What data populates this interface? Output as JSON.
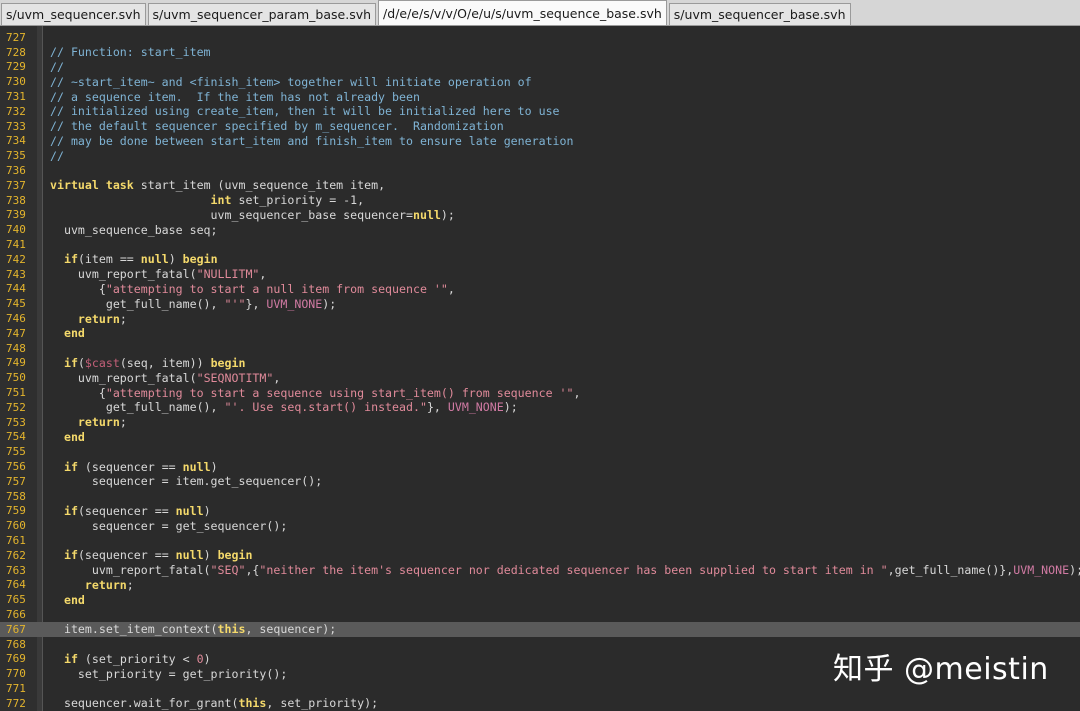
{
  "tabs": [
    {
      "label": "s/uvm_sequencer.svh",
      "active": false
    },
    {
      "label": "s/uvm_sequencer_param_base.svh",
      "active": false
    },
    {
      "label": "/d/e/e/s/v/v/O/e/u/s/uvm_sequence_base.svh",
      "active": true
    },
    {
      "label": "s/uvm_sequencer_base.svh",
      "active": false
    }
  ],
  "watermark": "知乎 @meistin",
  "colors": {
    "background": "#2b2b2b",
    "line_number": "#e4b52d",
    "comment": "#7fb3d4",
    "keyword": "#f4d96b",
    "string": "#e08a9a",
    "current_line": "#5a5a5a"
  },
  "code_lines": [
    {
      "n": "727",
      "t": [
        [
          "",
          ""
        ]
      ]
    },
    {
      "n": "728",
      "t": [
        [
          "com",
          "// Function: start_item"
        ]
      ]
    },
    {
      "n": "729",
      "t": [
        [
          "com",
          "//"
        ]
      ]
    },
    {
      "n": "730",
      "t": [
        [
          "com",
          "// ~start_item~ and <finish_item> together will initiate operation of"
        ]
      ]
    },
    {
      "n": "731",
      "t": [
        [
          "com",
          "// a sequence item.  If the item has not already been"
        ]
      ]
    },
    {
      "n": "732",
      "t": [
        [
          "com",
          "// initialized using create_item, then it will be initialized here to use"
        ]
      ]
    },
    {
      "n": "733",
      "t": [
        [
          "com",
          "// the default sequencer specified by m_sequencer.  Randomization"
        ]
      ]
    },
    {
      "n": "734",
      "t": [
        [
          "com",
          "// may be done between start_item and finish_item to ensure late generation"
        ]
      ]
    },
    {
      "n": "735",
      "t": [
        [
          "com",
          "//"
        ]
      ]
    },
    {
      "n": "736",
      "t": [
        [
          "",
          ""
        ]
      ]
    },
    {
      "n": "737",
      "t": [
        [
          "kw",
          "virtual task"
        ],
        [
          "",
          " start_item (uvm_sequence_item item,"
        ]
      ]
    },
    {
      "n": "738",
      "t": [
        [
          "",
          "                       "
        ],
        [
          "kw",
          "int"
        ],
        [
          "",
          " set_priority = -1,"
        ]
      ]
    },
    {
      "n": "739",
      "t": [
        [
          "",
          "                       uvm_sequencer_base sequencer="
        ],
        [
          "kw",
          "null"
        ],
        [
          "",
          ");"
        ]
      ]
    },
    {
      "n": "740",
      "t": [
        [
          "",
          "  uvm_sequence_base seq;"
        ]
      ]
    },
    {
      "n": "741",
      "t": [
        [
          "",
          ""
        ]
      ]
    },
    {
      "n": "742",
      "t": [
        [
          "",
          "  "
        ],
        [
          "kw",
          "if"
        ],
        [
          "",
          "(item == "
        ],
        [
          "kw",
          "null"
        ],
        [
          "",
          ") "
        ],
        [
          "kw",
          "begin"
        ]
      ]
    },
    {
      "n": "743",
      "t": [
        [
          "",
          "    uvm_report_fatal("
        ],
        [
          "str",
          "\"NULLITM\""
        ],
        [
          "",
          ","
        ]
      ]
    },
    {
      "n": "744",
      "t": [
        [
          "",
          "       {"
        ],
        [
          "str",
          "\"attempting to start a null item from sequence '\""
        ],
        [
          "",
          ","
        ]
      ]
    },
    {
      "n": "745",
      "t": [
        [
          "",
          "        get_full_name(), "
        ],
        [
          "str",
          "\"'\""
        ],
        [
          "",
          "}, "
        ],
        [
          "const",
          "UVM_NONE"
        ],
        [
          "",
          ");"
        ]
      ]
    },
    {
      "n": "746",
      "t": [
        [
          "",
          "    "
        ],
        [
          "kw",
          "return"
        ],
        [
          "",
          ";"
        ]
      ]
    },
    {
      "n": "747",
      "t": [
        [
          "",
          "  "
        ],
        [
          "kw",
          "end"
        ]
      ]
    },
    {
      "n": "748",
      "t": [
        [
          "",
          ""
        ]
      ]
    },
    {
      "n": "749",
      "t": [
        [
          "",
          "  "
        ],
        [
          "kw",
          "if"
        ],
        [
          "",
          "("
        ],
        [
          "sys",
          "$cast"
        ],
        [
          "",
          "(seq, item)) "
        ],
        [
          "kw",
          "begin"
        ]
      ]
    },
    {
      "n": "750",
      "t": [
        [
          "",
          "    uvm_report_fatal("
        ],
        [
          "str",
          "\"SEQNOTITM\""
        ],
        [
          "",
          ","
        ]
      ]
    },
    {
      "n": "751",
      "t": [
        [
          "",
          "       {"
        ],
        [
          "str",
          "\"attempting to start a sequence using start_item() from sequence '\""
        ],
        [
          "",
          ","
        ]
      ]
    },
    {
      "n": "752",
      "t": [
        [
          "",
          "        get_full_name(), "
        ],
        [
          "str",
          "\"'. Use seq.start() instead.\""
        ],
        [
          "",
          "}, "
        ],
        [
          "const",
          "UVM_NONE"
        ],
        [
          "",
          ");"
        ]
      ]
    },
    {
      "n": "753",
      "t": [
        [
          "",
          "    "
        ],
        [
          "kw",
          "return"
        ],
        [
          "",
          ";"
        ]
      ]
    },
    {
      "n": "754",
      "t": [
        [
          "",
          "  "
        ],
        [
          "kw",
          "end"
        ]
      ]
    },
    {
      "n": "755",
      "t": [
        [
          "",
          ""
        ]
      ]
    },
    {
      "n": "756",
      "t": [
        [
          "",
          "  "
        ],
        [
          "kw",
          "if"
        ],
        [
          "",
          " (sequencer == "
        ],
        [
          "kw",
          "null"
        ],
        [
          "",
          ")"
        ]
      ]
    },
    {
      "n": "757",
      "t": [
        [
          "",
          "      sequencer = item.get_sequencer();"
        ]
      ]
    },
    {
      "n": "758",
      "t": [
        [
          "",
          ""
        ]
      ]
    },
    {
      "n": "759",
      "t": [
        [
          "",
          "  "
        ],
        [
          "kw",
          "if"
        ],
        [
          "",
          "(sequencer == "
        ],
        [
          "kw",
          "null"
        ],
        [
          "",
          ")"
        ]
      ]
    },
    {
      "n": "760",
      "t": [
        [
          "",
          "      sequencer = get_sequencer();"
        ]
      ]
    },
    {
      "n": "761",
      "t": [
        [
          "",
          ""
        ]
      ]
    },
    {
      "n": "762",
      "t": [
        [
          "",
          "  "
        ],
        [
          "kw",
          "if"
        ],
        [
          "",
          "(sequencer == "
        ],
        [
          "kw",
          "null"
        ],
        [
          "",
          ") "
        ],
        [
          "kw",
          "begin"
        ]
      ]
    },
    {
      "n": "763",
      "t": [
        [
          "",
          "      uvm_report_fatal("
        ],
        [
          "str",
          "\"SEQ\""
        ],
        [
          "",
          ",{"
        ],
        [
          "str",
          "\"neither the item's sequencer nor dedicated sequencer has been supplied to start item in \""
        ],
        [
          "",
          ",get_full_name()},"
        ],
        [
          "const",
          "UVM_NONE"
        ],
        [
          "",
          ");"
        ]
      ]
    },
    {
      "n": "764",
      "t": [
        [
          "",
          "     "
        ],
        [
          "kw",
          "return"
        ],
        [
          "",
          ";"
        ]
      ]
    },
    {
      "n": "765",
      "t": [
        [
          "",
          "  "
        ],
        [
          "kw",
          "end"
        ]
      ]
    },
    {
      "n": "766",
      "t": [
        [
          "",
          ""
        ]
      ]
    },
    {
      "n": "767",
      "current": true,
      "t": [
        [
          "",
          "  item.set_item_context("
        ],
        [
          "kw",
          "this"
        ],
        [
          "",
          ", sequencer);"
        ]
      ]
    },
    {
      "n": "768",
      "t": [
        [
          "",
          ""
        ]
      ]
    },
    {
      "n": "769",
      "t": [
        [
          "",
          "  "
        ],
        [
          "kw",
          "if"
        ],
        [
          "",
          " (set_priority < "
        ],
        [
          "num",
          "0"
        ],
        [
          "",
          ")"
        ]
      ]
    },
    {
      "n": "770",
      "t": [
        [
          "",
          "    set_priority = get_priority();"
        ]
      ]
    },
    {
      "n": "771",
      "t": [
        [
          "",
          ""
        ]
      ]
    },
    {
      "n": "772",
      "t": [
        [
          "",
          "  sequencer.wait_for_grant("
        ],
        [
          "kw",
          "this"
        ],
        [
          "",
          ", set_priority);"
        ]
      ]
    }
  ]
}
